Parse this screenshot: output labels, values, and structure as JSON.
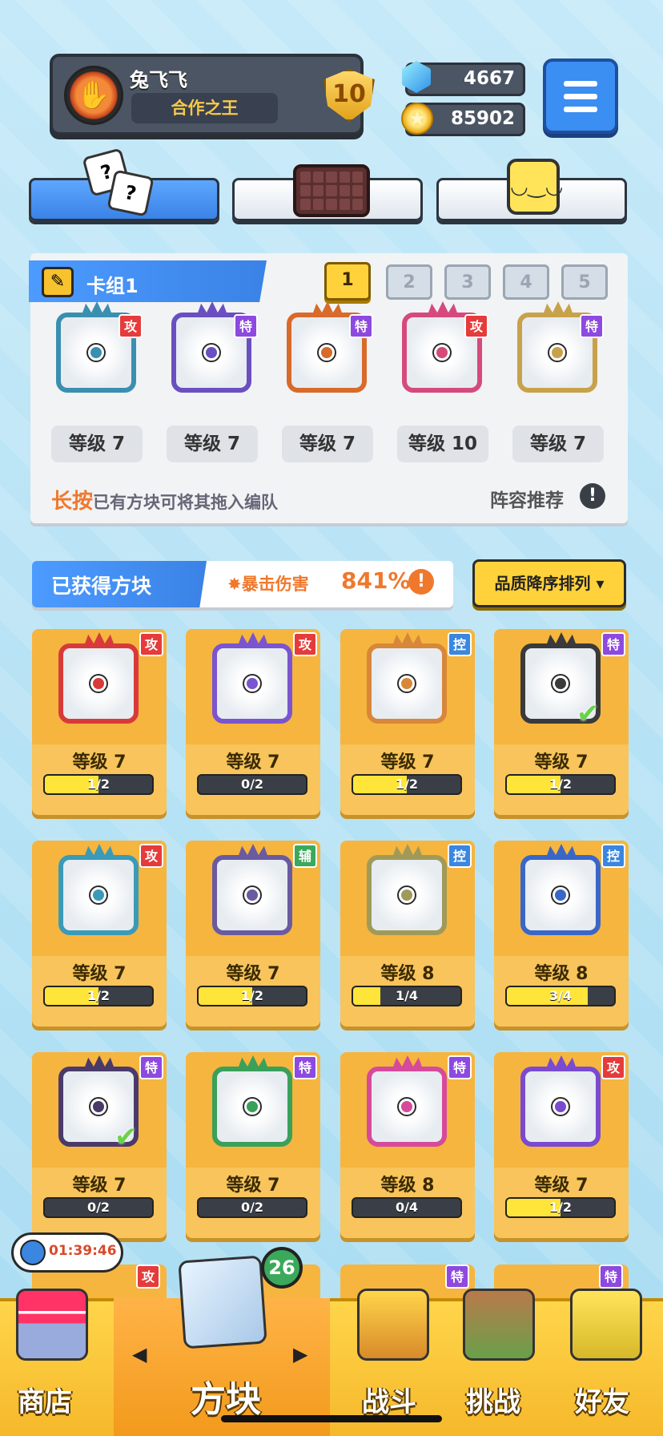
{
  "profile": {
    "name": "兔飞飞",
    "title": "合作之王",
    "rank": "10"
  },
  "currency": {
    "gems": "4667",
    "coins": "85902"
  },
  "deck": {
    "name": "卡组1",
    "tabs": [
      "1",
      "2",
      "3",
      "4",
      "5"
    ],
    "active_tab": "1",
    "cards": [
      {
        "tag": "攻",
        "level": "等级 7",
        "color": "#3a8fb0"
      },
      {
        "tag": "特",
        "level": "等级 7",
        "color": "#6a4fc0"
      },
      {
        "tag": "特",
        "level": "等级 7",
        "color": "#d86a2a"
      },
      {
        "tag": "攻",
        "level": "等级 10",
        "color": "#d64a7b"
      },
      {
        "tag": "特",
        "level": "等级 7",
        "color": "#c8a24a"
      }
    ],
    "hint_strong": "长按",
    "hint_rest": "已有方块可将其拖入编队",
    "recommend": "阵容推荐",
    "recommend_icon": "!"
  },
  "collection": {
    "title": "已获得方块",
    "crit_label": "暴击伤害",
    "crit_value": "841%",
    "crit_icon": "!",
    "sort_label": "品质降序排列 ▾",
    "cards": [
      {
        "tag": "攻",
        "level": "等级 7",
        "progress": "1/2",
        "fill": 0.5,
        "color": "#d83a3a"
      },
      {
        "tag": "攻",
        "level": "等级 7",
        "progress": "0/2",
        "fill": 0,
        "color": "#7a55d0"
      },
      {
        "tag": "控",
        "level": "等级 7",
        "progress": "1/2",
        "fill": 0.5,
        "color": "#d8873a"
      },
      {
        "tag": "特",
        "level": "等级 7",
        "progress": "1/2",
        "fill": 0.5,
        "color": "#3a3a3a",
        "check": true
      },
      {
        "tag": "攻",
        "level": "等级 7",
        "progress": "1/2",
        "fill": 0.5,
        "color": "#3a9ab8"
      },
      {
        "tag": "辅",
        "level": "等级 7",
        "progress": "1/2",
        "fill": 0.5,
        "color": "#6a5aa0"
      },
      {
        "tag": "控",
        "level": "等级 8",
        "progress": "1/4",
        "fill": 0.25,
        "color": "#a09a5a"
      },
      {
        "tag": "控",
        "level": "等级 8",
        "progress": "3/4",
        "fill": 0.75,
        "color": "#3a66c8"
      },
      {
        "tag": "特",
        "level": "等级 7",
        "progress": "0/2",
        "fill": 0,
        "color": "#4a3a6a",
        "check": true
      },
      {
        "tag": "特",
        "level": "等级 7",
        "progress": "0/2",
        "fill": 0,
        "color": "#3aa05a"
      },
      {
        "tag": "特",
        "level": "等级 8",
        "progress": "0/4",
        "fill": 0,
        "color": "#d64a9b"
      },
      {
        "tag": "攻",
        "level": "等级 7",
        "progress": "1/2",
        "fill": 0.5,
        "color": "#7a4ad0"
      }
    ]
  },
  "bottom": {
    "timer": "01:39:46",
    "badge": "26",
    "nav": [
      {
        "label": "商店",
        "icon": "shop-icon"
      },
      {
        "label": "方块",
        "icon": "block-icon"
      },
      {
        "label": "战斗",
        "icon": "battle-icon"
      },
      {
        "label": "挑战",
        "icon": "challenge-icon"
      },
      {
        "label": "好友",
        "icon": "friend-icon"
      }
    ],
    "arrow_left": "◀",
    "arrow_right": "▶"
  }
}
